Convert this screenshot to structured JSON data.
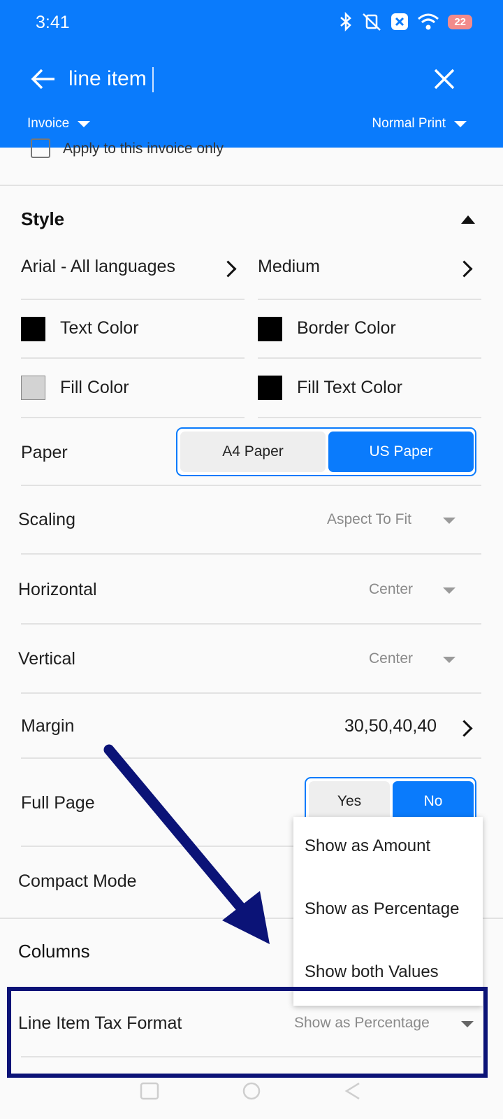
{
  "status": {
    "time": "3:41",
    "battery": "22"
  },
  "search": {
    "query": "line item"
  },
  "toolbar": {
    "doc_type": "Invoice",
    "print_mode": "Normal Print"
  },
  "apply_only": {
    "label": "Apply to this invoice only",
    "checked": false
  },
  "style": {
    "title": "Style",
    "font": "Arial - All languages",
    "size": "Medium",
    "text_color": {
      "label": "Text Color",
      "color": "#000000"
    },
    "border_color": {
      "label": "Border Color",
      "color": "#000000"
    },
    "fill_color": {
      "label": "Fill Color",
      "color": "#d3d3d3"
    },
    "fill_text_color": {
      "label": "Fill Text Color",
      "color": "#000000"
    },
    "paper": {
      "label": "Paper",
      "options": [
        "A4 Paper",
        "US Paper"
      ],
      "selected": "US Paper"
    },
    "scaling": {
      "label": "Scaling",
      "value": "Aspect To Fit"
    },
    "horizontal": {
      "label": "Horizontal",
      "value": "Center"
    },
    "vertical": {
      "label": "Vertical",
      "value": "Center"
    },
    "margin": {
      "label": "Margin",
      "value": "30,50,40,40"
    },
    "full_page": {
      "label": "Full Page",
      "options": [
        "Yes",
        "No"
      ],
      "selected": "No"
    },
    "compact_mode": {
      "label": "Compact Mode"
    }
  },
  "columns": {
    "title": "Columns",
    "line_item_tax_format": {
      "label": "Line Item Tax Format",
      "value": "Show as Percentage"
    }
  },
  "popup_menu": {
    "items": [
      "Show as Amount",
      "Show as Percentage",
      "Show both Values"
    ]
  },
  "colors": {
    "accent": "#0a7bfc",
    "annotation": "#0b1377"
  }
}
